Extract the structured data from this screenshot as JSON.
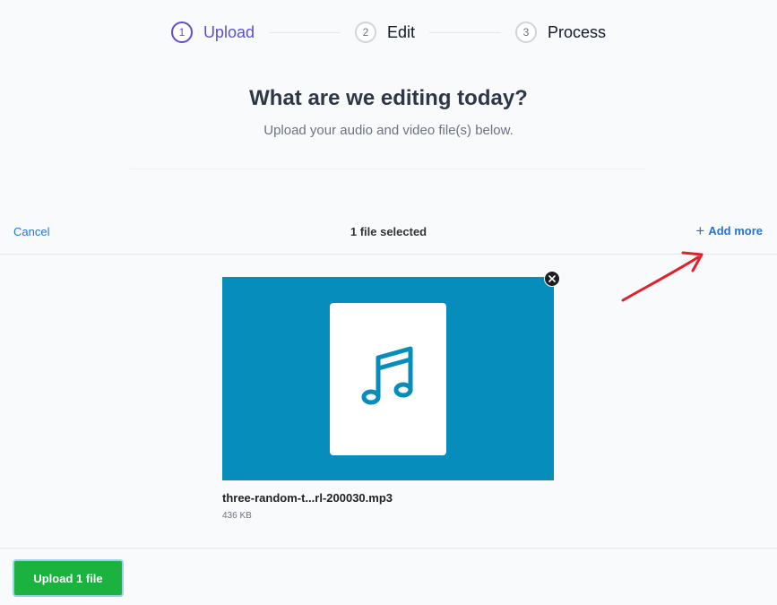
{
  "stepper": {
    "steps": [
      {
        "number": "1",
        "label": "Upload",
        "active": true
      },
      {
        "number": "2",
        "label": "Edit",
        "active": false
      },
      {
        "number": "3",
        "label": "Process",
        "active": false
      }
    ]
  },
  "header": {
    "title": "What are we editing today?",
    "subtitle": "Upload your audio and video file(s) below."
  },
  "dashboard": {
    "cancel_label": "Cancel",
    "selected_count": "1 file selected",
    "add_more_label": "Add more",
    "add_more_icon": "plus-icon"
  },
  "files": [
    {
      "name": "three-random-t...rl-200030.mp3",
      "size": "436 KB",
      "icon": "music-note-icon",
      "preview_color": "#068dbb"
    }
  ],
  "footer": {
    "upload_label": "Upload 1 file"
  },
  "colors": {
    "accent": "#5b4fd8",
    "link": "#2275d7",
    "upload_button": "#1bb240",
    "annotation_arrow": "#e0202a"
  }
}
